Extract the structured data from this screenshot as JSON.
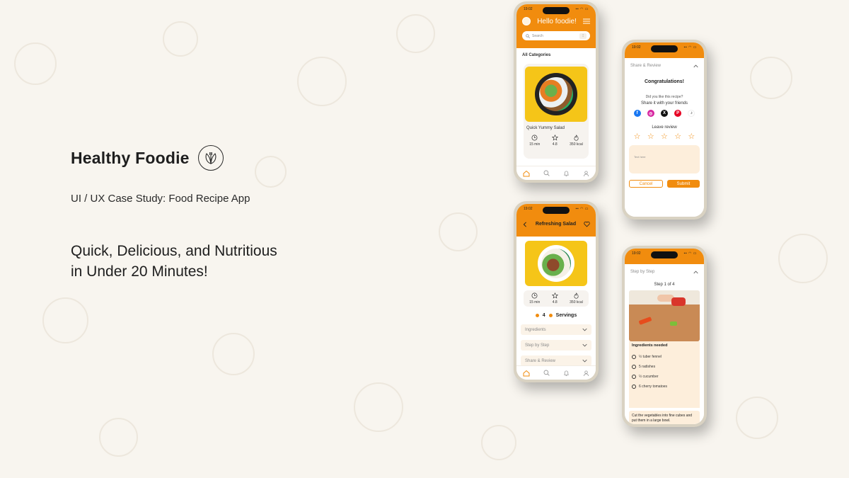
{
  "brand": {
    "title": "Healthy Foodie",
    "subtitle": "UI / UX Case Study: Food Recipe App"
  },
  "tagline": {
    "line1": "Quick, Delicious, and Nutritious",
    "line2": "in Under 20 Minutes!"
  },
  "colors": {
    "accent": "#f18c0e",
    "cream": "#fbf3e8",
    "background": "#f8f5ef"
  },
  "phone_home": {
    "time": "19:02",
    "greeting": "Hello foodie!",
    "search_placeholder": "Search",
    "section": "All Categories",
    "card_title": "Quick Yummy Salad",
    "meta": {
      "time": "15 min",
      "rating": "4.8",
      "calories": "350 kcal"
    }
  },
  "phone_detail": {
    "time": "19:02",
    "title": "Refreshing Salad",
    "meta": {
      "time": "15 min",
      "rating": "4.8",
      "calories": "350 kcal"
    },
    "servings_count": "4",
    "servings_label": "Servings",
    "accordions": [
      "Ingredients",
      "Step by Step",
      "Share & Review"
    ]
  },
  "phone_review": {
    "time": "19:02",
    "section": "Share & Review",
    "congrats": "Congratulations!",
    "question": "Did you like this recipe?",
    "share_prompt": "Share it with your friends",
    "leave_review": "Leave review",
    "textarea_placeholder": "Text here",
    "cancel": "Cancel",
    "submit": "Submit"
  },
  "phone_steps": {
    "time": "19:02",
    "section": "Step by Step",
    "step": "Step 1 of 4",
    "ingredients_heading": "Ingredients needed",
    "ingredients": [
      "½ tuber fennel",
      "5 radishes",
      "½ cucumber",
      "6 cherry tomatoes"
    ],
    "instruction": "Cut the vegetables into fine cubes and put them in a large bowl."
  }
}
